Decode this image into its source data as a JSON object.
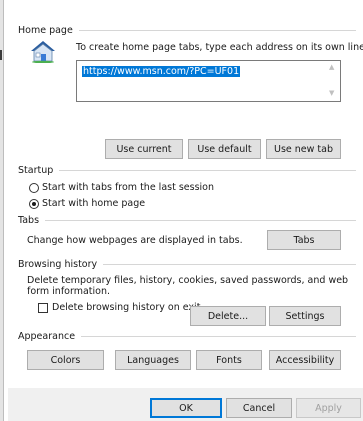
{
  "home_page": {
    "group_label": "Home page",
    "instruction": "To create home page tabs, type each address on its own line.",
    "url_value": "https://www.msn.com/?PC=UF01",
    "buttons": {
      "use_current": "Use current",
      "use_default": "Use default",
      "use_new_tab": "Use new tab"
    }
  },
  "startup": {
    "group_label": "Startup",
    "options": [
      "Start with tabs from the last session",
      "Start with home page"
    ],
    "selected_index": 1
  },
  "tabs": {
    "group_label": "Tabs",
    "description": "Change how webpages are displayed in tabs.",
    "button": "Tabs"
  },
  "browsing_history": {
    "group_label": "Browsing history",
    "description_line1": "Delete temporary files, history, cookies, saved passwords, and web",
    "description_line2": "form information.",
    "delete_on_exit_label": "Delete browsing history on exit",
    "delete_on_exit_checked": false,
    "buttons": {
      "delete": "Delete...",
      "settings": "Settings"
    }
  },
  "appearance": {
    "group_label": "Appearance",
    "buttons": [
      "Colors",
      "Languages",
      "Fonts",
      "Accessibility"
    ]
  },
  "dialog_buttons": {
    "ok": "OK",
    "cancel": "Cancel",
    "apply": "Apply"
  }
}
